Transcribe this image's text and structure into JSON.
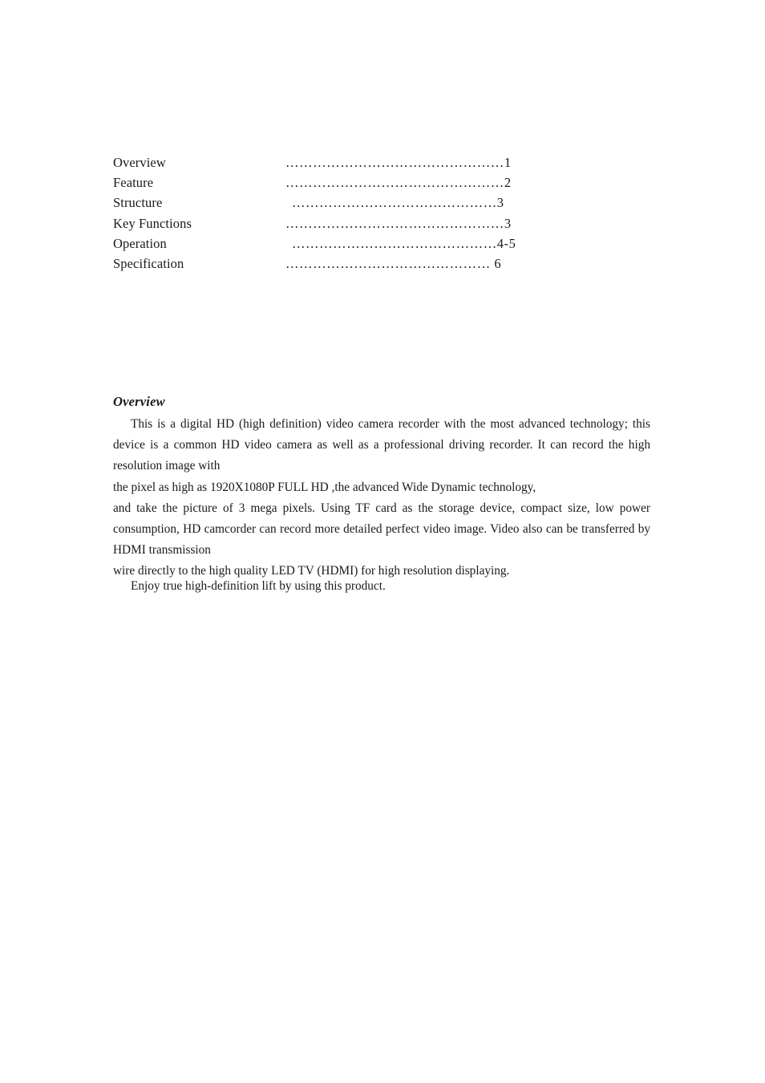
{
  "document": {
    "page_background": "#ffffff",
    "text_color": "#1a1a1a"
  },
  "toc": {
    "leader_dots": "……………………………………………",
    "entries": [
      {
        "label": "Overview",
        "leader": "…………………………………………",
        "page": "1"
      },
      {
        "label": "Feature",
        "leader": "…………………………………………",
        "page": "2"
      },
      {
        "label": "Structure",
        "leader": "………………………………………",
        "page": "3"
      },
      {
        "label": "Key Functions",
        "leader": "…………………………………………",
        "page": "3"
      },
      {
        "label": "Operation",
        "leader": "………………………………………",
        "page": "4-5"
      },
      {
        "label": "Specification",
        "leader": "………………………………………",
        "page": " 6"
      }
    ]
  },
  "overview": {
    "heading": "Overview",
    "paragraph_1_line_1": "This is a digital HD (high definition) video camera recorder with the most advanced technology; this device is a common HD video camera as well as a professional driving recorder. It can record the high resolution image with",
    "paragraph_1_line_2": "the pixel as high as 1920X1080P FULL HD ,the advanced Wide Dynamic technology,",
    "paragraph_2_line_1": "and take the picture of 3 mega pixels. Using TF card as the storage device, compact size, low power consumption, HD camcorder can record more detailed perfect video image. Video also can be transferred by HDMI transmission",
    "paragraph_2_line_2": "wire directly to the high quality LED TV (HDMI) for high resolution displaying.",
    "closing": "Enjoy true high-definition lift by using this product."
  }
}
